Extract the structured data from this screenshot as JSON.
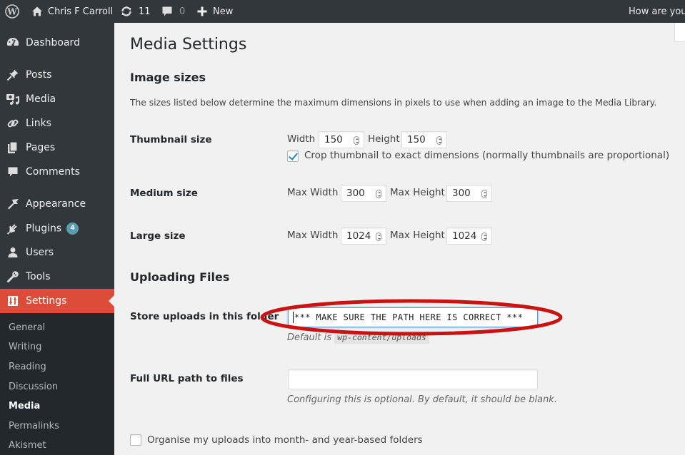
{
  "adminbar": {
    "wp_logo": "wordpress-logo-icon",
    "site_name": "Chris F Carroll",
    "updates_count": "11",
    "comments_count": "0",
    "new_label": "New",
    "account_greeting": "How are you,"
  },
  "sidebar": {
    "items": [
      {
        "label": "Dashboard",
        "icon": "dashboard-icon"
      },
      {
        "label": "Posts",
        "icon": "pin-icon"
      },
      {
        "label": "Media",
        "icon": "media-icon"
      },
      {
        "label": "Links",
        "icon": "link-icon"
      },
      {
        "label": "Pages",
        "icon": "pages-icon"
      },
      {
        "label": "Comments",
        "icon": "comment-icon"
      },
      {
        "label": "Appearance",
        "icon": "paintbrush-icon"
      },
      {
        "label": "Plugins",
        "icon": "plugin-icon",
        "badge": "4"
      },
      {
        "label": "Users",
        "icon": "user-icon"
      },
      {
        "label": "Tools",
        "icon": "wrench-icon"
      },
      {
        "label": "Settings",
        "icon": "settings-icon",
        "current": true
      }
    ],
    "submenu": [
      {
        "label": "General"
      },
      {
        "label": "Writing"
      },
      {
        "label": "Reading"
      },
      {
        "label": "Discussion"
      },
      {
        "label": "Media",
        "current": true
      },
      {
        "label": "Permalinks"
      },
      {
        "label": "Akismet"
      }
    ]
  },
  "page": {
    "title": "Media Settings",
    "image_sizes": {
      "heading": "Image sizes",
      "description": "The sizes listed below determine the maximum dimensions in pixels to use when adding an image to the Media Library.",
      "thumbnail": {
        "label": "Thumbnail size",
        "width_label": "Width",
        "width_value": "150",
        "height_label": "Height",
        "height_value": "150",
        "crop_checked": true,
        "crop_label": "Crop thumbnail to exact dimensions (normally thumbnails are proportional)"
      },
      "medium": {
        "label": "Medium size",
        "width_label": "Max Width",
        "width_value": "300",
        "height_label": "Max Height",
        "height_value": "300"
      },
      "large": {
        "label": "Large size",
        "width_label": "Max Width",
        "width_value": "1024",
        "height_label": "Max Height",
        "height_value": "1024"
      }
    },
    "uploading": {
      "heading": "Uploading Files",
      "store_label": "Store uploads in this folder",
      "store_value": "*** MAKE SURE THE PATH HERE IS CORRECT ***",
      "store_default_prefix": "Default is",
      "store_default_code": "wp-content/uploads",
      "url_label": "Full URL path to files",
      "url_value": "",
      "url_description": "Configuring this is optional. By default, it should be blank.",
      "organise_checked": false,
      "organise_label": "Organise my uploads into month- and year-based folders"
    }
  },
  "annotation": {
    "color": "#cc1111",
    "shape": "ellipse",
    "target": "store-uploads-input"
  }
}
